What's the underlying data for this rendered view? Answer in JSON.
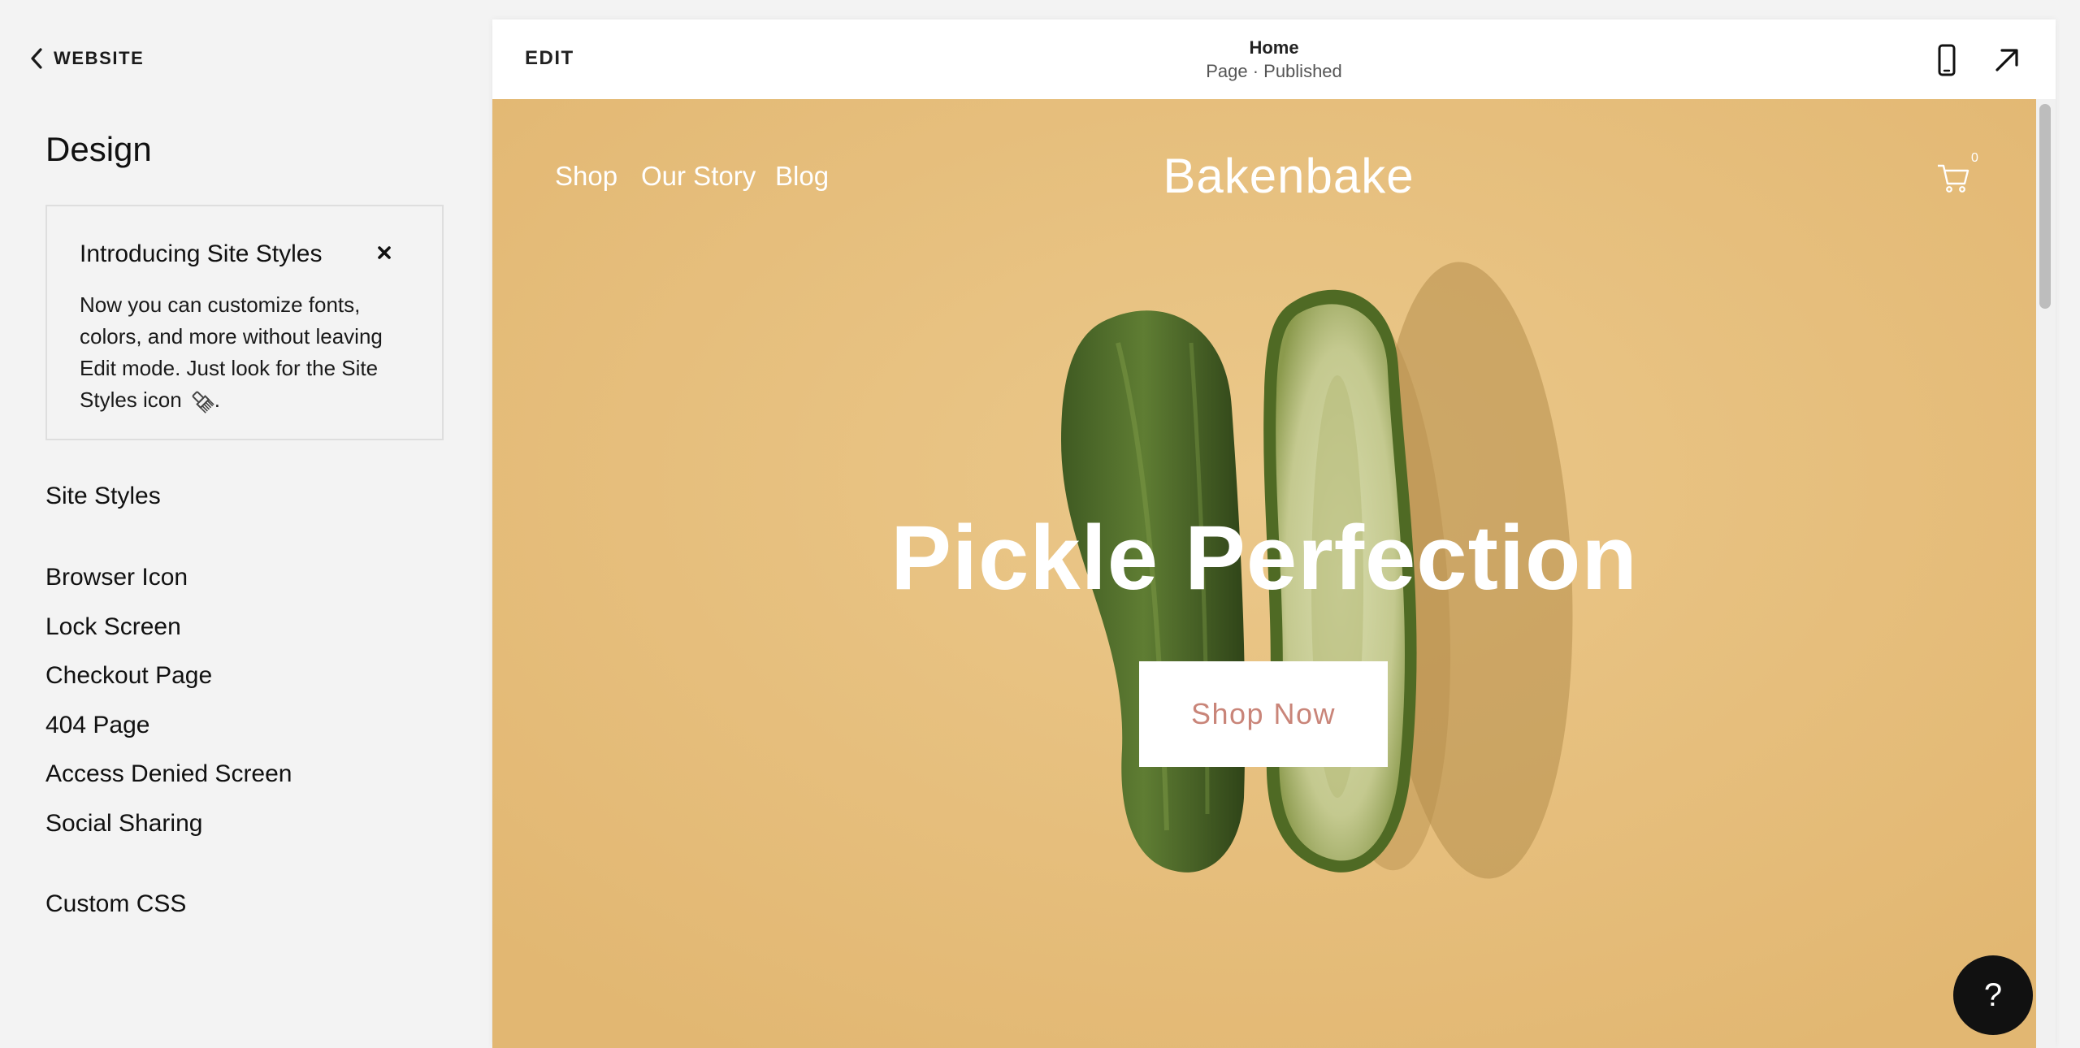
{
  "sidebar": {
    "back_label": "WEBSITE",
    "title": "Design",
    "intro": {
      "title": "Introducing Site Styles",
      "text": "Now you can customize fonts, colors, and more without leaving Edit mode. Just look for the Site Styles icon",
      "text_end": "."
    },
    "items": [
      {
        "label": "Site Styles"
      },
      {
        "label": "Browser Icon"
      },
      {
        "label": "Lock Screen"
      },
      {
        "label": "Checkout Page"
      },
      {
        "label": "404 Page"
      },
      {
        "label": "Access Denied Screen"
      },
      {
        "label": "Social Sharing"
      },
      {
        "label": "Custom CSS"
      }
    ]
  },
  "topbar": {
    "edit_label": "EDIT",
    "page_name": "Home",
    "page_status": "Page · Published"
  },
  "site": {
    "nav": [
      {
        "label": "Shop"
      },
      {
        "label": "Our Story"
      },
      {
        "label": "Blog"
      }
    ],
    "logo": "Bakenbake",
    "cart_count": "0",
    "hero_title": "Pickle Perfection",
    "cta_label": "Shop Now",
    "help_label": "?"
  },
  "colors": {
    "hero_background": "#e6bf7c",
    "cta_text": "#c98579",
    "sidebar_background": "#f3f3f3"
  },
  "icons": [
    "chevron-left-icon",
    "close-icon",
    "paintbrush-icon",
    "mobile-icon",
    "expand-arrow-icon",
    "cart-icon",
    "help-icon"
  ]
}
